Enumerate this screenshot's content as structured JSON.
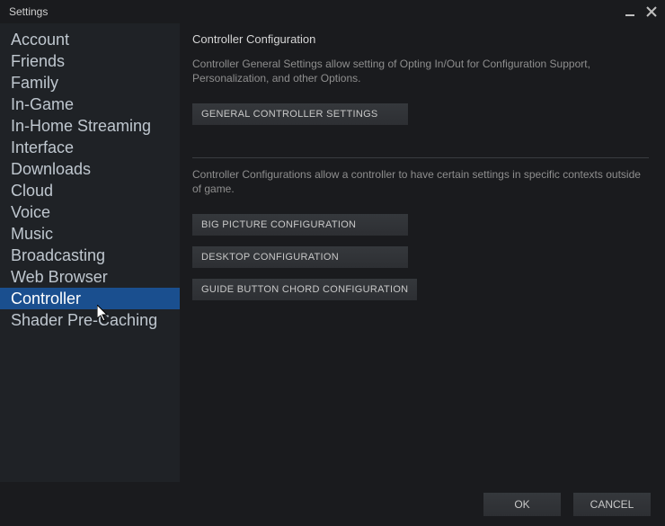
{
  "window": {
    "title": "Settings"
  },
  "sidebar": {
    "items": [
      {
        "label": "Account",
        "selected": false
      },
      {
        "label": "Friends",
        "selected": false
      },
      {
        "label": "Family",
        "selected": false
      },
      {
        "label": "In-Game",
        "selected": false
      },
      {
        "label": "In-Home Streaming",
        "selected": false
      },
      {
        "label": "Interface",
        "selected": false
      },
      {
        "label": "Downloads",
        "selected": false
      },
      {
        "label": "Cloud",
        "selected": false
      },
      {
        "label": "Voice",
        "selected": false
      },
      {
        "label": "Music",
        "selected": false
      },
      {
        "label": "Broadcasting",
        "selected": false
      },
      {
        "label": "Web Browser",
        "selected": false
      },
      {
        "label": "Controller",
        "selected": true
      },
      {
        "label": "Shader Pre-Caching",
        "selected": false
      }
    ]
  },
  "main": {
    "title": "Controller Configuration",
    "desc1": "Controller General Settings allow setting of Opting In/Out for Configuration Support, Personalization, and other Options.",
    "btn_general": "GENERAL CONTROLLER SETTINGS",
    "desc2": "Controller Configurations allow a controller to have certain settings in specific contexts outside of game.",
    "btn_bigpicture": "BIG PICTURE CONFIGURATION",
    "btn_desktop": "DESKTOP CONFIGURATION",
    "btn_guide": "GUIDE BUTTON CHORD CONFIGURATION"
  },
  "footer": {
    "ok": "OK",
    "cancel": "CANCEL"
  }
}
